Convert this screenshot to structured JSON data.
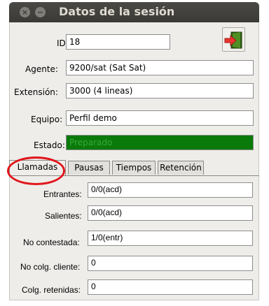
{
  "window": {
    "title": "Datos de la sesión"
  },
  "session": {
    "id_label": "ID:",
    "id_value": "18",
    "agente_label": "Agente:",
    "agente_value": "9200/sat (Sat Sat)",
    "extension_label": "Extensión:",
    "extension_value": "3000 (4 lineas)",
    "equipo_label": "Equipo:",
    "equipo_value": "Perfil demo",
    "estado_label": "Estado:",
    "estado_value": "Preparado",
    "estado_color": "#0a7a0a"
  },
  "exit_button": {
    "icon": "exit-door-icon"
  },
  "tabs": [
    {
      "label": "Llamadas",
      "active": true
    },
    {
      "label": "Pausas",
      "active": false
    },
    {
      "label": "Tiempos",
      "active": false
    },
    {
      "label": "Retención",
      "active": false
    }
  ],
  "llamadas": {
    "entrantes_label": "Entrantes:",
    "entrantes_value": "0/0(acd)",
    "salientes_label": "Salientes:",
    "salientes_value": "0/0(acd)",
    "no_contestada_label": "No contestada:",
    "no_contestada_value": "1/0(entr)",
    "no_colg_cliente_label": "No colg. cliente:",
    "no_colg_cliente_value": "0",
    "colg_retenidas_label": "Colg. retenidas:",
    "colg_retenidas_value": "0"
  },
  "annotation": {
    "highlight_color": "#e0161b"
  }
}
